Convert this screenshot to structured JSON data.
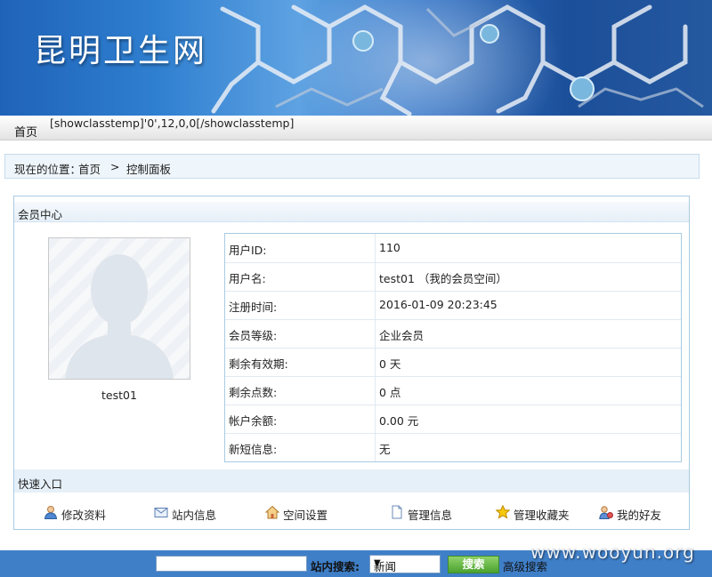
{
  "header": {
    "site_title": "昆明卫生网"
  },
  "nav": {
    "home": "首页",
    "template_text": "[showclasstemp]'0',12,0,0[/showclasstemp]"
  },
  "breadcrumb": {
    "prefix": "现在的位置：",
    "home": "首页",
    "separator": ">",
    "current": "控制面板"
  },
  "member_center": {
    "title": "会员中心",
    "username_display": "test01",
    "info_rows": [
      {
        "label": "用户ID:",
        "value": "110"
      },
      {
        "label": "用户名:",
        "value": "test01 （我的会员空间）"
      },
      {
        "label": "注册时间:",
        "value": "2016-01-09 20:23:45"
      },
      {
        "label": "会员等级:",
        "value": "企业会员"
      },
      {
        "label": "剩余有效期:",
        "value": "0 天"
      },
      {
        "label": "剩余点数:",
        "value": "0 点"
      },
      {
        "label": "帐户余额:",
        "value": "0.00 元"
      },
      {
        "label": "新短信息:",
        "value": "无"
      }
    ]
  },
  "quick_entry": {
    "title": "快速入口",
    "items": [
      {
        "label": "修改资料",
        "icon": "user-edit-icon"
      },
      {
        "label": "站内信息",
        "icon": "mail-icon"
      },
      {
        "label": "空间设置",
        "icon": "home-icon"
      },
      {
        "label": "管理信息",
        "icon": "document-icon"
      },
      {
        "label": "管理收藏夹",
        "icon": "star-icon"
      },
      {
        "label": "我的好友",
        "icon": "friends-icon"
      }
    ]
  },
  "footer_search": {
    "input_value": "",
    "label": "站内搜索:",
    "selected_option": "新闻",
    "button_label": "搜索",
    "advanced_link": "高级搜索"
  },
  "watermark": "www.wooyun.org",
  "colors": {
    "footer_bar": "#3f7fc8",
    "panel_border": "#a9cbe3",
    "search_button": "#4aa22f"
  }
}
